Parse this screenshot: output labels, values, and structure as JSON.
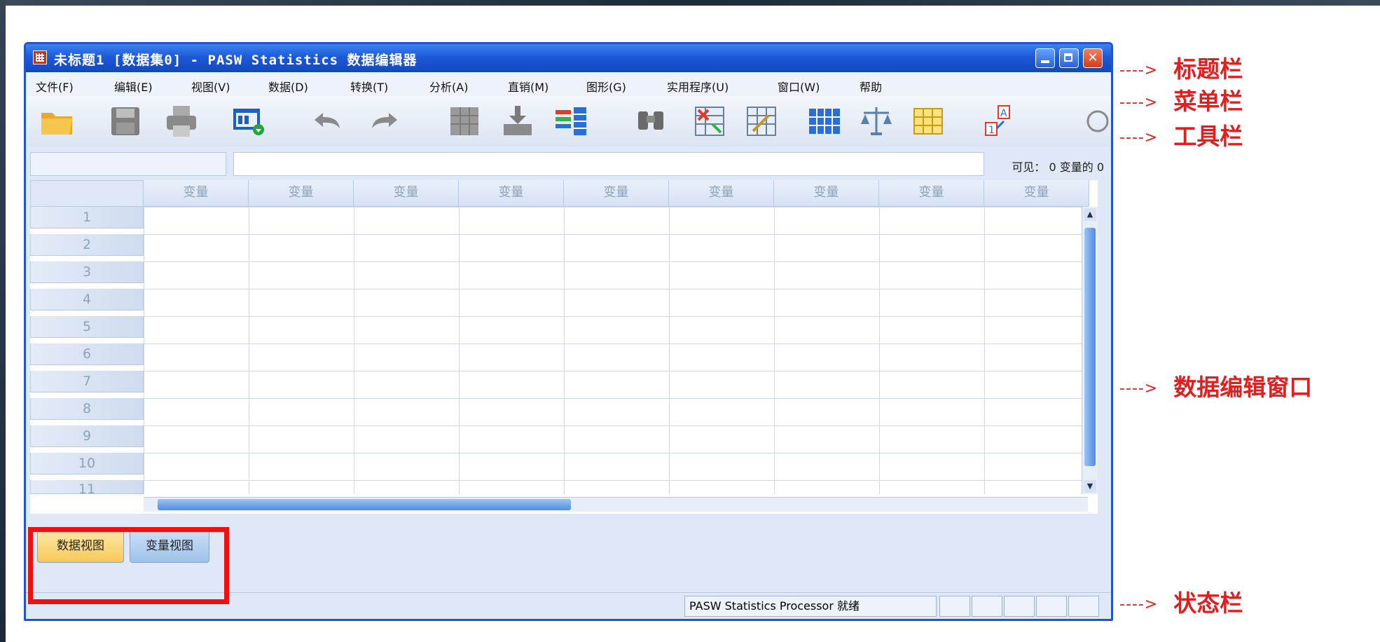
{
  "window": {
    "title": "未标题1 [数据集0] - PASW Statistics 数据编辑器"
  },
  "menu": {
    "items": [
      "文件(F)",
      "编辑(E)",
      "视图(V)",
      "数据(D)",
      "转换(T)",
      "分析(A)",
      "直销(M)",
      "图形(G)",
      "实用程序(U)",
      "窗口(W)",
      "帮助"
    ]
  },
  "toolbar": {
    "icons": [
      "open-folder-icon",
      "save-icon",
      "print-icon",
      "dialog-recall-icon",
      "undo-icon",
      "redo-icon",
      "goto-case-icon",
      "goto-variable-icon",
      "variables-icon",
      "find-icon",
      "insert-cases-icon",
      "insert-variable-icon",
      "split-file-icon",
      "weight-cases-icon",
      "select-cases-icon",
      "value-labels-icon"
    ]
  },
  "cell_editor": {
    "visible_label": "可见： 0 变量的 0"
  },
  "grid": {
    "column_header": "变量",
    "columns": [
      "变量",
      "变量",
      "变量",
      "变量",
      "变量",
      "变量",
      "变量",
      "变量",
      "变量"
    ],
    "rows": [
      "1",
      "2",
      "3",
      "4",
      "5",
      "6",
      "7",
      "8",
      "9",
      "10",
      "11"
    ]
  },
  "tabs": {
    "data_view": "数据视图",
    "variable_view": "变量视图"
  },
  "status": {
    "text": "PASW Statistics Processor 就绪"
  },
  "annotations": {
    "arrow": "---->",
    "title_bar": "标题栏",
    "menu_bar": "菜单栏",
    "toolbar": "工具栏",
    "data_window": "数据编辑窗口",
    "status_bar": "状态栏"
  },
  "colors": {
    "title_blue": "#1d5ad8",
    "annotation_red": "#e31e1e",
    "active_tab": "#f7c857"
  }
}
